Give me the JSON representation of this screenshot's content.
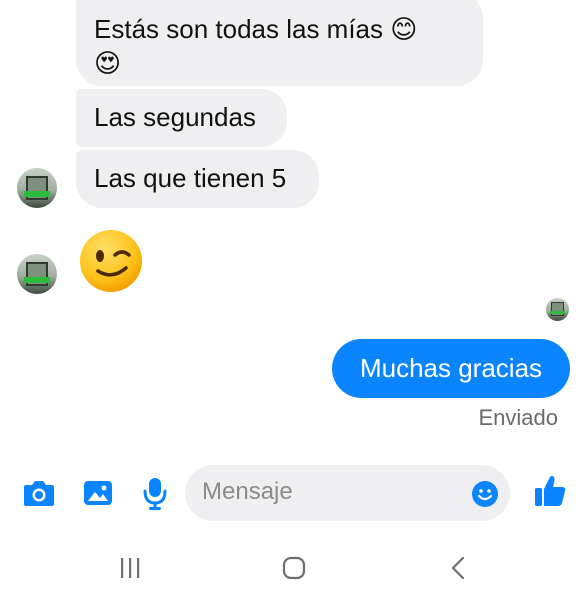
{
  "conversation": {
    "messages_in": [
      {
        "text_line1": "Estás son todas las mías 😊",
        "text_line2": "😍"
      },
      {
        "text": "Las segundas"
      },
      {
        "text": "Las que tienen 5"
      }
    ],
    "wink_emoji": "wink-emoji",
    "message_out": {
      "text": "Muchas gracias",
      "status": "Enviado"
    }
  },
  "composer": {
    "placeholder": "Mensaje",
    "icons": [
      "camera-icon",
      "gallery-icon",
      "microphone-icon",
      "emoji-icon",
      "like-icon"
    ]
  },
  "navbar": {
    "icons": [
      "recent-apps-icon",
      "home-icon",
      "back-icon"
    ]
  },
  "colors": {
    "accent": "#0b84ff",
    "incoming_bubble": "#efeff1",
    "status_text": "#6a6a6a"
  }
}
